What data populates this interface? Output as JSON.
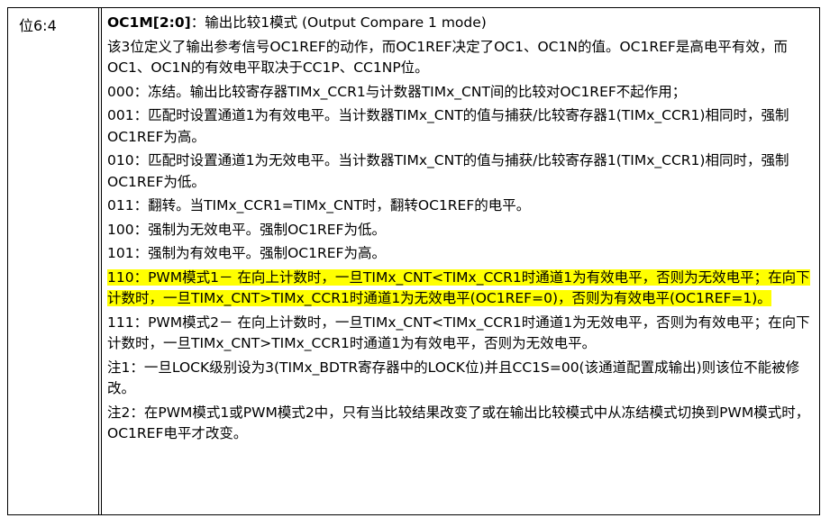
{
  "field": {
    "bits": "位6:4",
    "name": "OC1M[2:0]",
    "title_rest": "：输出比较1模式 (Output Compare 1 mode)"
  },
  "paragraphs": [
    {
      "id": "desc1",
      "text": "该3位定义了输出参考信号OC1REF的动作，而OC1REF决定了OC1、OC1N的值。OC1REF是高电平有效，而OC1、OC1N的有效电平取决于CC1P、CC1NP位。"
    },
    {
      "id": "m000",
      "text": "000：冻结。输出比较寄存器TIMx_CCR1与计数器TIMx_CNT间的比较对OC1REF不起作用；"
    },
    {
      "id": "m001",
      "text": "001：匹配时设置通道1为有效电平。当计数器TIMx_CNT的值与捕获/比较寄存器1(TIMx_CCR1)相同时，强制OC1REF为高。"
    },
    {
      "id": "m010",
      "text": "010：匹配时设置通道1为无效电平。当计数器TIMx_CNT的值与捕获/比较寄存器1(TIMx_CCR1)相同时，强制OC1REF为低。"
    },
    {
      "id": "m011",
      "text": "011：翻转。当TIMx_CCR1=TIMx_CNT时，翻转OC1REF的电平。"
    },
    {
      "id": "m100",
      "text": "100：强制为无效电平。强制OC1REF为低。"
    },
    {
      "id": "m101",
      "text": "101：强制为有效电平。强制OC1REF为高。"
    },
    {
      "id": "m110",
      "text": "110：PWM模式1－ 在向上计数时，一旦TIMx_CNT<TIMx_CCR1时通道1为有效电平，否则为无效电平；在向下计数时，一旦TIMx_CNT>TIMx_CCR1时通道1为无效电平(OC1REF=0)，否则为有效电平(OC1REF=1)。"
    },
    {
      "id": "m111",
      "text": "111：PWM模式2－ 在向上计数时，一旦TIMx_CNT<TIMx_CCR1时通道1为无效电平，否则为有效电平；在向下计数时，一旦TIMx_CNT>TIMx_CCR1时通道1为有效电平，否则为无效电平。"
    },
    {
      "id": "note1",
      "text": "注1：一旦LOCK级别设为3(TIMx_BDTR寄存器中的LOCK位)并且CC1S=00(该通道配置成输出)则该位不能被修改。"
    },
    {
      "id": "note2",
      "text": "注2：在PWM模式1或PWM模式2中，只有当比较结果改变了或在输出比较模式中从冻结模式切换到PWM模式时，OC1REF电平才改变。"
    }
  ],
  "highlight_color": "#ffff00"
}
